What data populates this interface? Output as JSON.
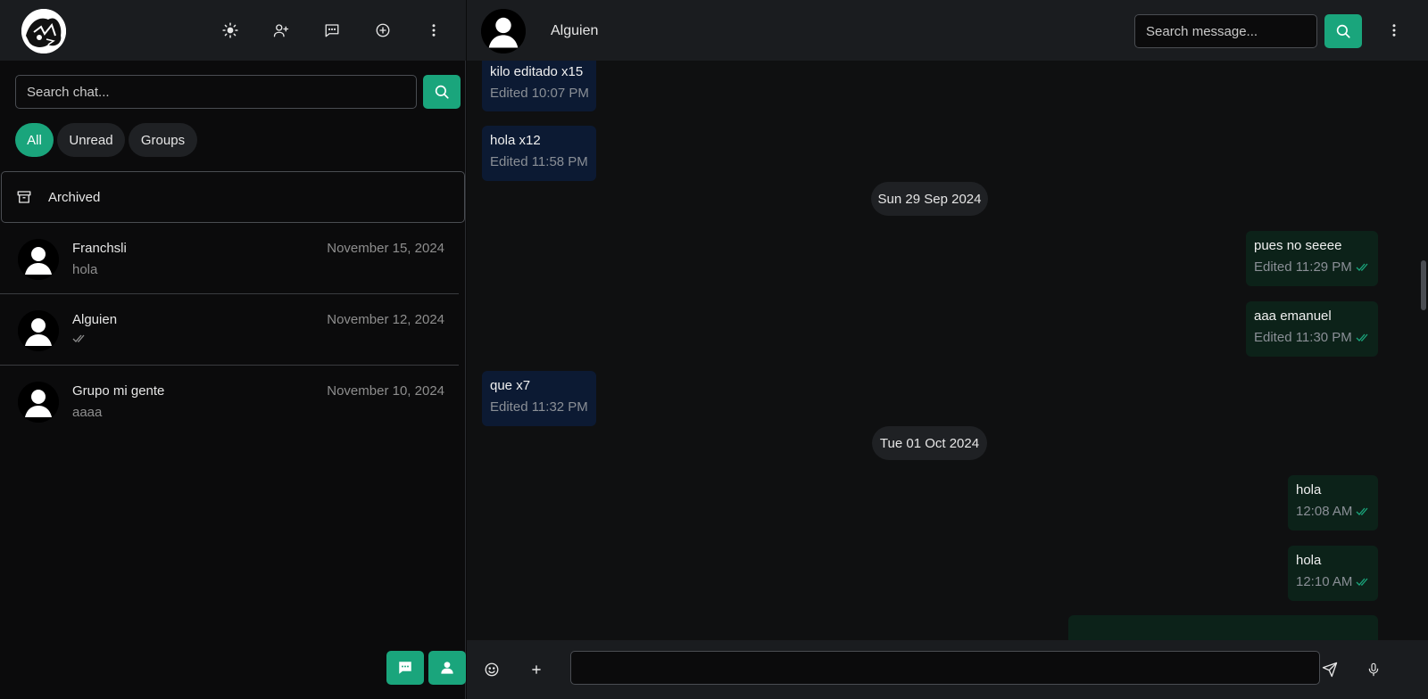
{
  "colors": {
    "accent": "#1aa57c",
    "incoming_bubble": "#0c1a33",
    "outgoing_bubble": "#0c2219",
    "read_ticks": "#1aa57c"
  },
  "sidebar": {
    "search": {
      "placeholder": "Search chat..."
    },
    "filters": [
      "All",
      "Unread",
      "Groups"
    ],
    "active_filter": "All",
    "archived_label": "Archived",
    "chats": [
      {
        "name": "Franchsli",
        "date": "November 15, 2024",
        "preview": "hola"
      },
      {
        "name": "Alguien",
        "date": "November 12, 2024",
        "preview": ""
      },
      {
        "name": "Grupo mi gente",
        "date": "November 10, 2024",
        "preview": "aaaa"
      }
    ]
  },
  "chat": {
    "title": "Alguien",
    "search": {
      "placeholder": "Search message..."
    },
    "messages": [
      {
        "dir": "in",
        "text": "kilo editado x15",
        "meta": "Edited 10:07 PM"
      },
      {
        "dir": "in",
        "text": "hola x12",
        "meta": "Edited 11:58 PM"
      },
      {
        "date": "Sun 29 Sep 2024"
      },
      {
        "dir": "out",
        "text": "pues no seeee",
        "meta": "Edited 11:29 PM",
        "read": true
      },
      {
        "dir": "out",
        "text": "aaa emanuel",
        "meta": "Edited 11:30 PM",
        "read": true
      },
      {
        "dir": "in",
        "text": "que x7",
        "meta": "Edited 11:32 PM"
      },
      {
        "date": "Tue 01 Oct 2024"
      },
      {
        "dir": "out",
        "text": "hola",
        "meta": "12:08 AM",
        "read": true
      },
      {
        "dir": "out",
        "text": "hola",
        "meta": "12:10 AM",
        "read": true
      }
    ],
    "composer": {
      "placeholder": ""
    }
  }
}
